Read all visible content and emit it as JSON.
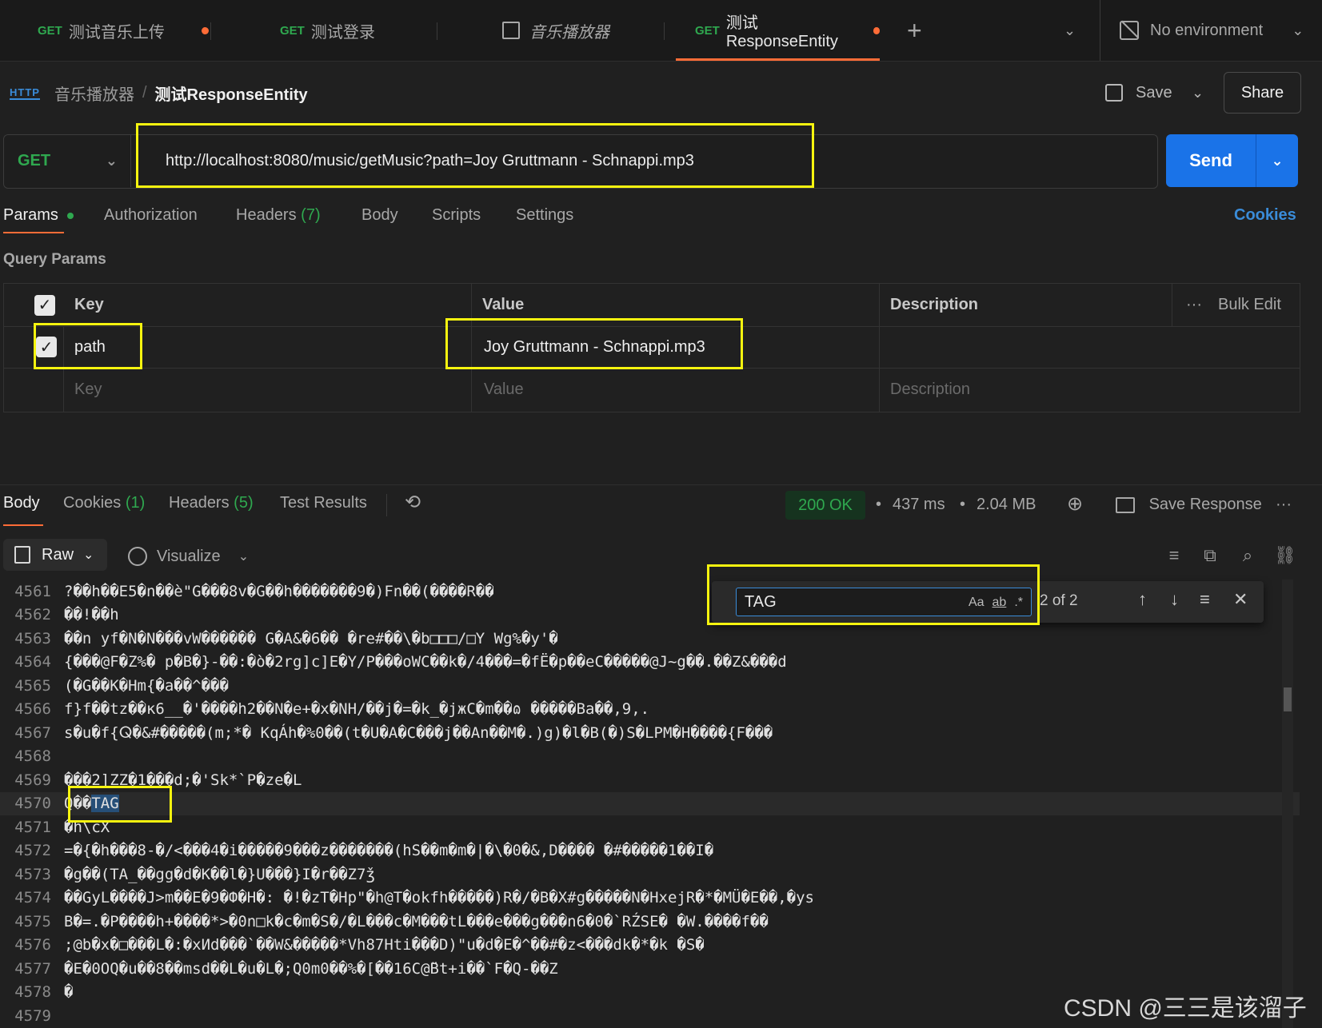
{
  "tabs": [
    {
      "method": "GET",
      "label": "测试音乐上传",
      "unsaved": true
    },
    {
      "method": "GET",
      "label": "测试登录",
      "unsaved": false
    },
    {
      "method": "",
      "label": "音乐播放器",
      "unsaved": false
    },
    {
      "method": "GET",
      "label": "测试ResponseEntity",
      "unsaved": true
    }
  ],
  "environment": "No environment",
  "breadcrumb": {
    "icon": "HTTP",
    "parent": "音乐播放器",
    "current": "测试ResponseEntity"
  },
  "actions": {
    "save": "Save",
    "share": "Share"
  },
  "request": {
    "method": "GET",
    "url": "http://localhost:8080/music/getMusic?path=Joy Gruttmann - Schnappi.mp3",
    "send": "Send"
  },
  "request_tabs": {
    "params": "Params",
    "authorization": "Authorization",
    "headers": "Headers",
    "headers_count": "(7)",
    "body": "Body",
    "scripts": "Scripts",
    "settings": "Settings",
    "cookies": "Cookies"
  },
  "query_params": {
    "title": "Query Params",
    "columns": {
      "key": "Key",
      "value": "Value",
      "description": "Description",
      "bulk_edit": "Bulk Edit"
    },
    "rows": [
      {
        "key": "path",
        "value": "Joy Gruttmann - Schnappi.mp3",
        "checked": true
      }
    ],
    "placeholders": {
      "key": "Key",
      "value": "Value",
      "description": "Description"
    }
  },
  "response": {
    "tabs": {
      "body": "Body",
      "cookies": "Cookies",
      "cookies_count": "(1)",
      "headers": "Headers",
      "headers_count": "(5)",
      "tests": "Test Results"
    },
    "status": "200 OK",
    "time": "437 ms",
    "size": "2.04 MB",
    "save_response": "Save Response",
    "format": "Raw",
    "visualize": "Visualize"
  },
  "find": {
    "query": "TAG",
    "match_case": "Aa",
    "whole_word": "ab",
    "regex": ".*",
    "result": "2 of 2"
  },
  "code_lines": [
    {
      "n": "4561",
      "t": "?��h��E5�n��è\"G���8v�G��h�������9�)Fn��(����R��"
    },
    {
      "n": "4562",
      "t": "��!��h"
    },
    {
      "n": "4563",
      "t": "��n yf�N�N���vW������ G�A&�6�� �re#��\\�b□□□/□Y Wg%�y'�"
    },
    {
      "n": "4564",
      "t": "{���@F�Z%� p�B�}-��:�ò�2rg]c]E�Y/P���oWC��k�/4���=�fË�p��eC�����@J~g��.��Z&���d"
    },
    {
      "n": "4565",
      "t": "(�G��K�Hm{�a��^���"
    },
    {
      "n": "4566",
      "t": "f}f��tz��ĸ6__�'����h2��N�e+�x�NH/��j�=�k_�jжC�m��ɷ �����Ba��,9,."
    },
    {
      "n": "4567",
      "t": "s�u�f{ⵕ�&#�����(m;*� KqÁh�%0��(t�U�A�C���j��An��M�.)g)�l�B(�)S�LPM�H����{F���"
    },
    {
      "n": "4568",
      "t": ""
    },
    {
      "n": "4569",
      "t": "���2]ZZ�1���d;�'Sk*`P�ze�L"
    },
    {
      "n": "4570",
      "t": "Q��",
      "match": "TAG"
    },
    {
      "n": "4571",
      "t": "�h\\cX"
    },
    {
      "n": "4572",
      "t": "=�{�h���8-�/<���4�i�����9���z�������(hS��m�m�|�\\�0�&,D���� �#�����1��I�"
    },
    {
      "n": "4573",
      "t": "�g��(TA_��gg�d�K��l�}U���}I�r��Z7ǯ"
    },
    {
      "n": "4574",
      "t": "��GyL����J>m��E�9�Ф�H�: �!�zT�Hp\"�h@T�okfh�����)R�/�B�X#g�����N�HxejR�*�MÜ�E��,�ys"
    },
    {
      "n": "4575",
      "t": "B�=.�P����h+����*>�0n□k�c�m�S�/�L���c�M���tL���e���g���n6�0�`RŹSE� �W.����f��"
    },
    {
      "n": "4576",
      "t": ";@b�x�□���L�:�xИd���`��W&�����*Vh87Hti���D)\"u�d�E�^��#�z<���dk�*�k �S�"
    },
    {
      "n": "4577",
      "t": "�E�0OQ�u��8��msd��L�u�L�;Q0m0��%�[��16C@̈Bt+i��`F�Q-��Z"
    },
    {
      "n": "4578",
      "t": "�"
    },
    {
      "n": "4579",
      "t": ""
    }
  ],
  "watermark": "CSDN @三三是该溜子"
}
